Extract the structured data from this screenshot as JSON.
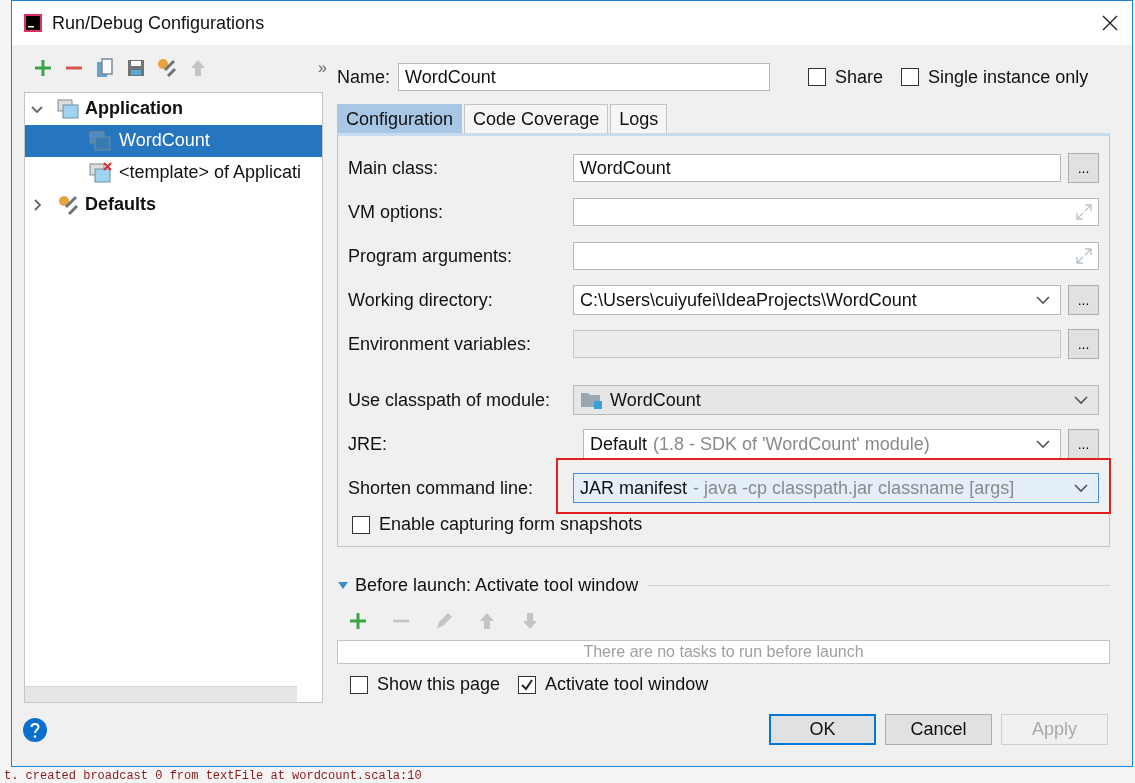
{
  "window": {
    "title": "Run/Debug Configurations"
  },
  "toolbar": [
    {
      "kind": "add",
      "disabled": false
    },
    {
      "kind": "remove",
      "disabled": false
    },
    {
      "kind": "copy",
      "disabled": false
    },
    {
      "kind": "save",
      "disabled": false
    },
    {
      "kind": "wrench",
      "disabled": false
    },
    {
      "kind": "up",
      "disabled": true
    }
  ],
  "toolbar_more": "»",
  "tree": [
    {
      "label": "Application",
      "kind": "app",
      "expanded": true,
      "selected": false,
      "children": [
        {
          "label": "WordCount",
          "kind": "config",
          "selected": true
        },
        {
          "label": "<template> of Applicati",
          "kind": "template",
          "selected": false
        }
      ]
    },
    {
      "label": "Defaults",
      "kind": "defaults",
      "expanded": false,
      "selected": false
    }
  ],
  "name": {
    "label": "Name:",
    "value": "WordCount"
  },
  "options": [
    {
      "label": "Share",
      "checked": false
    },
    {
      "label": "Single instance only",
      "checked": false
    }
  ],
  "tabs": [
    {
      "label": "Configuration",
      "selected": true
    },
    {
      "label": "Code Coverage",
      "selected": false
    },
    {
      "label": "Logs",
      "selected": false
    }
  ],
  "fields": [
    {
      "kind": "text",
      "label": "Main class:",
      "value": "WordCount",
      "browse": "..."
    },
    {
      "kind": "expand",
      "label": "VM options:"
    },
    {
      "kind": "expand",
      "label": "Program arguments:"
    },
    {
      "kind": "combo",
      "label": "Working directory:",
      "value": "C:\\Users\\cuiyufei\\IdeaProjects\\WordCount",
      "browse": "..."
    },
    {
      "kind": "text",
      "label": "Environment variables:",
      "disabled": true,
      "browse": "..."
    },
    {
      "kind": "module",
      "label": "Use classpath of module:",
      "value": "WordCount"
    },
    {
      "kind": "combo",
      "label": "JRE:",
      "value": "Default",
      "hint": "(1.8 - SDK of 'WordCount' module)",
      "browse": "..."
    },
    {
      "kind": "combo",
      "label": "Shorten command line:",
      "value": "JAR manifest",
      "hint": "- java -cp classpath.jar classname [args]",
      "highlighted": true
    }
  ],
  "snapshot": {
    "label": "Enable capturing form snapshots",
    "checked": false
  },
  "before_launch": {
    "title": "Before launch: Activate tool window",
    "expanded": true,
    "tools": [
      {
        "kind": "add",
        "disabled": false
      },
      {
        "kind": "remove",
        "disabled": true
      },
      {
        "kind": "edit",
        "disabled": true
      },
      {
        "kind": "up",
        "disabled": true
      },
      {
        "kind": "down",
        "disabled": true
      }
    ],
    "empty_text": "There are no tasks to run before launch"
  },
  "bottom_options": [
    {
      "label": "Show this page",
      "checked": false
    },
    {
      "label": "Activate tool window",
      "checked": true
    }
  ],
  "buttons": [
    {
      "label": "OK",
      "default": true,
      "disabled": false
    },
    {
      "label": "Cancel",
      "default": false,
      "disabled": false
    },
    {
      "label": "Apply",
      "default": false,
      "disabled": true
    }
  ],
  "console_line": "t. created broadcast 0 from textFile at wordcount.scala:10"
}
